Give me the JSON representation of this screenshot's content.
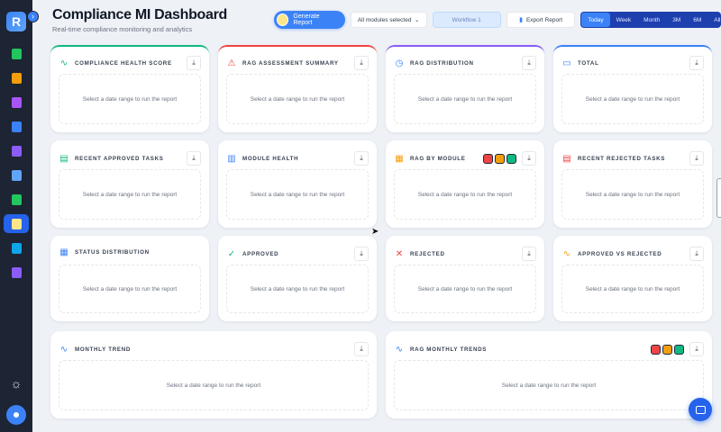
{
  "sidebar": {
    "logo": "R",
    "collapse_icon": "›",
    "items": [
      {
        "icon": "document-icon",
        "color": "#22c55e",
        "active": false
      },
      {
        "icon": "calendar-icon",
        "color": "#f59e0b",
        "active": false
      },
      {
        "icon": "users-icon",
        "color": "#a855f7",
        "active": false
      },
      {
        "icon": "shield-icon",
        "color": "#3b82f6",
        "active": false
      },
      {
        "icon": "clipboard-icon",
        "color": "#8b5cf6",
        "active": false
      },
      {
        "icon": "id-card-icon",
        "color": "#60a5fa",
        "active": false
      },
      {
        "icon": "money-icon",
        "color": "#22c55e",
        "active": false
      },
      {
        "icon": "chart-icon",
        "color": "#f59e0b",
        "active": true
      },
      {
        "icon": "report-icon",
        "color": "#0ea5e9",
        "active": false
      },
      {
        "icon": "list-icon",
        "color": "#8b5cf6",
        "active": false
      }
    ],
    "theme_icon": "☼"
  },
  "header": {
    "title": "Compliance MI Dashboard",
    "subtitle": "Real-time compliance monitoring and analytics"
  },
  "toolbar": {
    "generate_label": "Generate Report",
    "modules_select": "All modules selected",
    "workflow": "Workflow 1",
    "export_label": "Export Report",
    "ranges": [
      "Today",
      "Week",
      "Month",
      "3M",
      "6M",
      "All"
    ],
    "active_range": "Today"
  },
  "empty_text": "Select a date range to run the report",
  "cards": [
    {
      "title": "COMPLIANCE HEALTH SCORE",
      "icon": "pulse-icon",
      "glyph": "∿",
      "icon_color": "#10b981",
      "accent": "#10b981"
    },
    {
      "title": "RAG ASSESSMENT SUMMARY",
      "icon": "warning-icon",
      "glyph": "⚠",
      "icon_color": "#ef4444",
      "accent": "#ef4444"
    },
    {
      "title": "RAG DISTRIBUTION",
      "icon": "clock-icon",
      "glyph": "◷",
      "icon_color": "#3b82f6",
      "accent": "#8b5cf6"
    },
    {
      "title": "TOTAL",
      "icon": "clipboard-icon",
      "glyph": "▭",
      "icon_color": "#3b82f6",
      "accent": "#3b82f6"
    },
    {
      "title": "RECENT APPROVED TASKS",
      "icon": "file-check-icon",
      "glyph": "▤",
      "icon_color": "#10b981",
      "accent": ""
    },
    {
      "title": "MODULE HEALTH",
      "icon": "bar-chart-icon",
      "glyph": "▥",
      "icon_color": "#3b82f6",
      "accent": ""
    },
    {
      "title": "RAG BY MODULE",
      "icon": "grid-icon",
      "glyph": "▦",
      "icon_color": "#f59e0b",
      "accent": "",
      "swatches": [
        "#ef4444",
        "#f59e0b",
        "#10b981"
      ]
    },
    {
      "title": "RECENT REJECTED TASKS",
      "icon": "file-x-icon",
      "glyph": "▤",
      "icon_color": "#ef4444",
      "accent": ""
    },
    {
      "title": "STATUS DISTRIBUTION",
      "icon": "table-icon",
      "glyph": "▦",
      "icon_color": "#3b82f6",
      "accent": ""
    },
    {
      "title": "APPROVED",
      "icon": "check-circle-icon",
      "glyph": "✓",
      "icon_color": "#10b981",
      "accent": ""
    },
    {
      "title": "REJECTED",
      "icon": "x-circle-icon",
      "glyph": "✕",
      "icon_color": "#ef4444",
      "accent": ""
    },
    {
      "title": "APPROVED VS REJECTED",
      "icon": "pulse-icon",
      "glyph": "∿",
      "icon_color": "#f59e0b",
      "accent": ""
    },
    {
      "title": "MONTHLY TREND",
      "icon": "pulse-icon",
      "glyph": "∿",
      "icon_color": "#3b82f6",
      "accent": ""
    },
    {
      "title": "RAG MONTHLY TRENDS",
      "icon": "pulse-icon",
      "glyph": "∿",
      "icon_color": "#3b82f6",
      "accent": "",
      "swatches": [
        "#ef4444",
        "#f59e0b",
        "#10b981"
      ]
    }
  ]
}
